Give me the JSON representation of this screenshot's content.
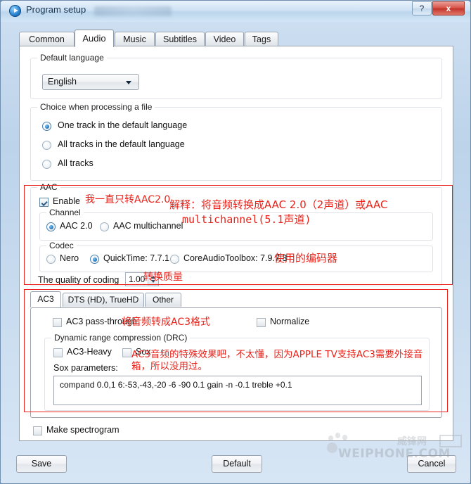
{
  "window": {
    "title": "Program setup",
    "icon": "play-circle-icon",
    "help_label": "?",
    "close_label": "x"
  },
  "tabs": [
    {
      "label": "Common",
      "active": false
    },
    {
      "label": "Audio",
      "active": true
    },
    {
      "label": "Music",
      "active": false
    },
    {
      "label": "Subtitles",
      "active": false
    },
    {
      "label": "Video",
      "active": false
    },
    {
      "label": "Tags",
      "active": false
    }
  ],
  "default_language": {
    "legend": "Default language",
    "selected": "English"
  },
  "choice": {
    "legend": "Choice when processing a file",
    "options": [
      {
        "label": "One track in the default language",
        "selected": true
      },
      {
        "label": "All tracks in the default language",
        "selected": false
      },
      {
        "label": "All tracks",
        "selected": false
      }
    ]
  },
  "aac": {
    "legend": "AAC",
    "enable_label": "Enable",
    "enable_checked": true,
    "channel": {
      "legend": "Channel",
      "options": [
        {
          "label": "AAC 2.0",
          "selected": true
        },
        {
          "label": "AAC multichannel",
          "selected": false
        }
      ]
    },
    "codec": {
      "legend": "Codec",
      "options": [
        {
          "label": "Nero",
          "selected": false
        },
        {
          "label": "QuickTime: 7.7.1",
          "selected": true
        },
        {
          "label": "CoreAudioToolbox: 7.9.7.3",
          "selected": false
        }
      ]
    },
    "quality_label": "The quality of coding",
    "quality_value": "1.00"
  },
  "ac3": {
    "subtabs": [
      {
        "label": "AC3",
        "active": true
      },
      {
        "label": "DTS (HD), TrueHD",
        "active": false
      },
      {
        "label": "Other",
        "active": false
      }
    ],
    "passthrough_label": "AC3 pass-through",
    "passthrough_checked": false,
    "normalize_label": "Normalize",
    "normalize_checked": false,
    "drc": {
      "legend": "Dynamic range compression (DRC)",
      "heavy_label": "AC3-Heavy",
      "heavy_checked": false,
      "sox_label": "Sox",
      "sox_checked": false,
      "sox_params_label": "Sox parameters:",
      "sox_params_value": "compand 0.0,1 6:-53,-43,-20 -6 -90 0.1 gain -n -0.1 treble +0.1"
    }
  },
  "spectrogram": {
    "label": "Make spectrogram",
    "checked": false
  },
  "footer": {
    "save_label": "Save",
    "default_label": "Default",
    "cancel_label": "Cancel"
  },
  "annotations": {
    "aac_note_1": "我一直只转AAC2.0",
    "aac_note_2_line1": "解释：将音频转换成AAC 2.0（2声道）或AAC",
    "aac_note_2_line2": "multichannel(5.1声道)",
    "codec_note": "使用的编码器",
    "quality_note": "转换质量",
    "ac3_note": "将音频转成AC3格式",
    "sox_note_line1": "AC3音频的特殊效果吧，不太懂，因为APPLE TV支持AC3需要外接音",
    "sox_note_line2": "箱，所以没用过。"
  },
  "watermark": {
    "text": "WEIPHONE.COM",
    "cn": "威锋网"
  },
  "colors": {
    "annotation_red": "#e8221a",
    "title_bar": "#cfe2f4",
    "close_button": "#c2362b"
  }
}
